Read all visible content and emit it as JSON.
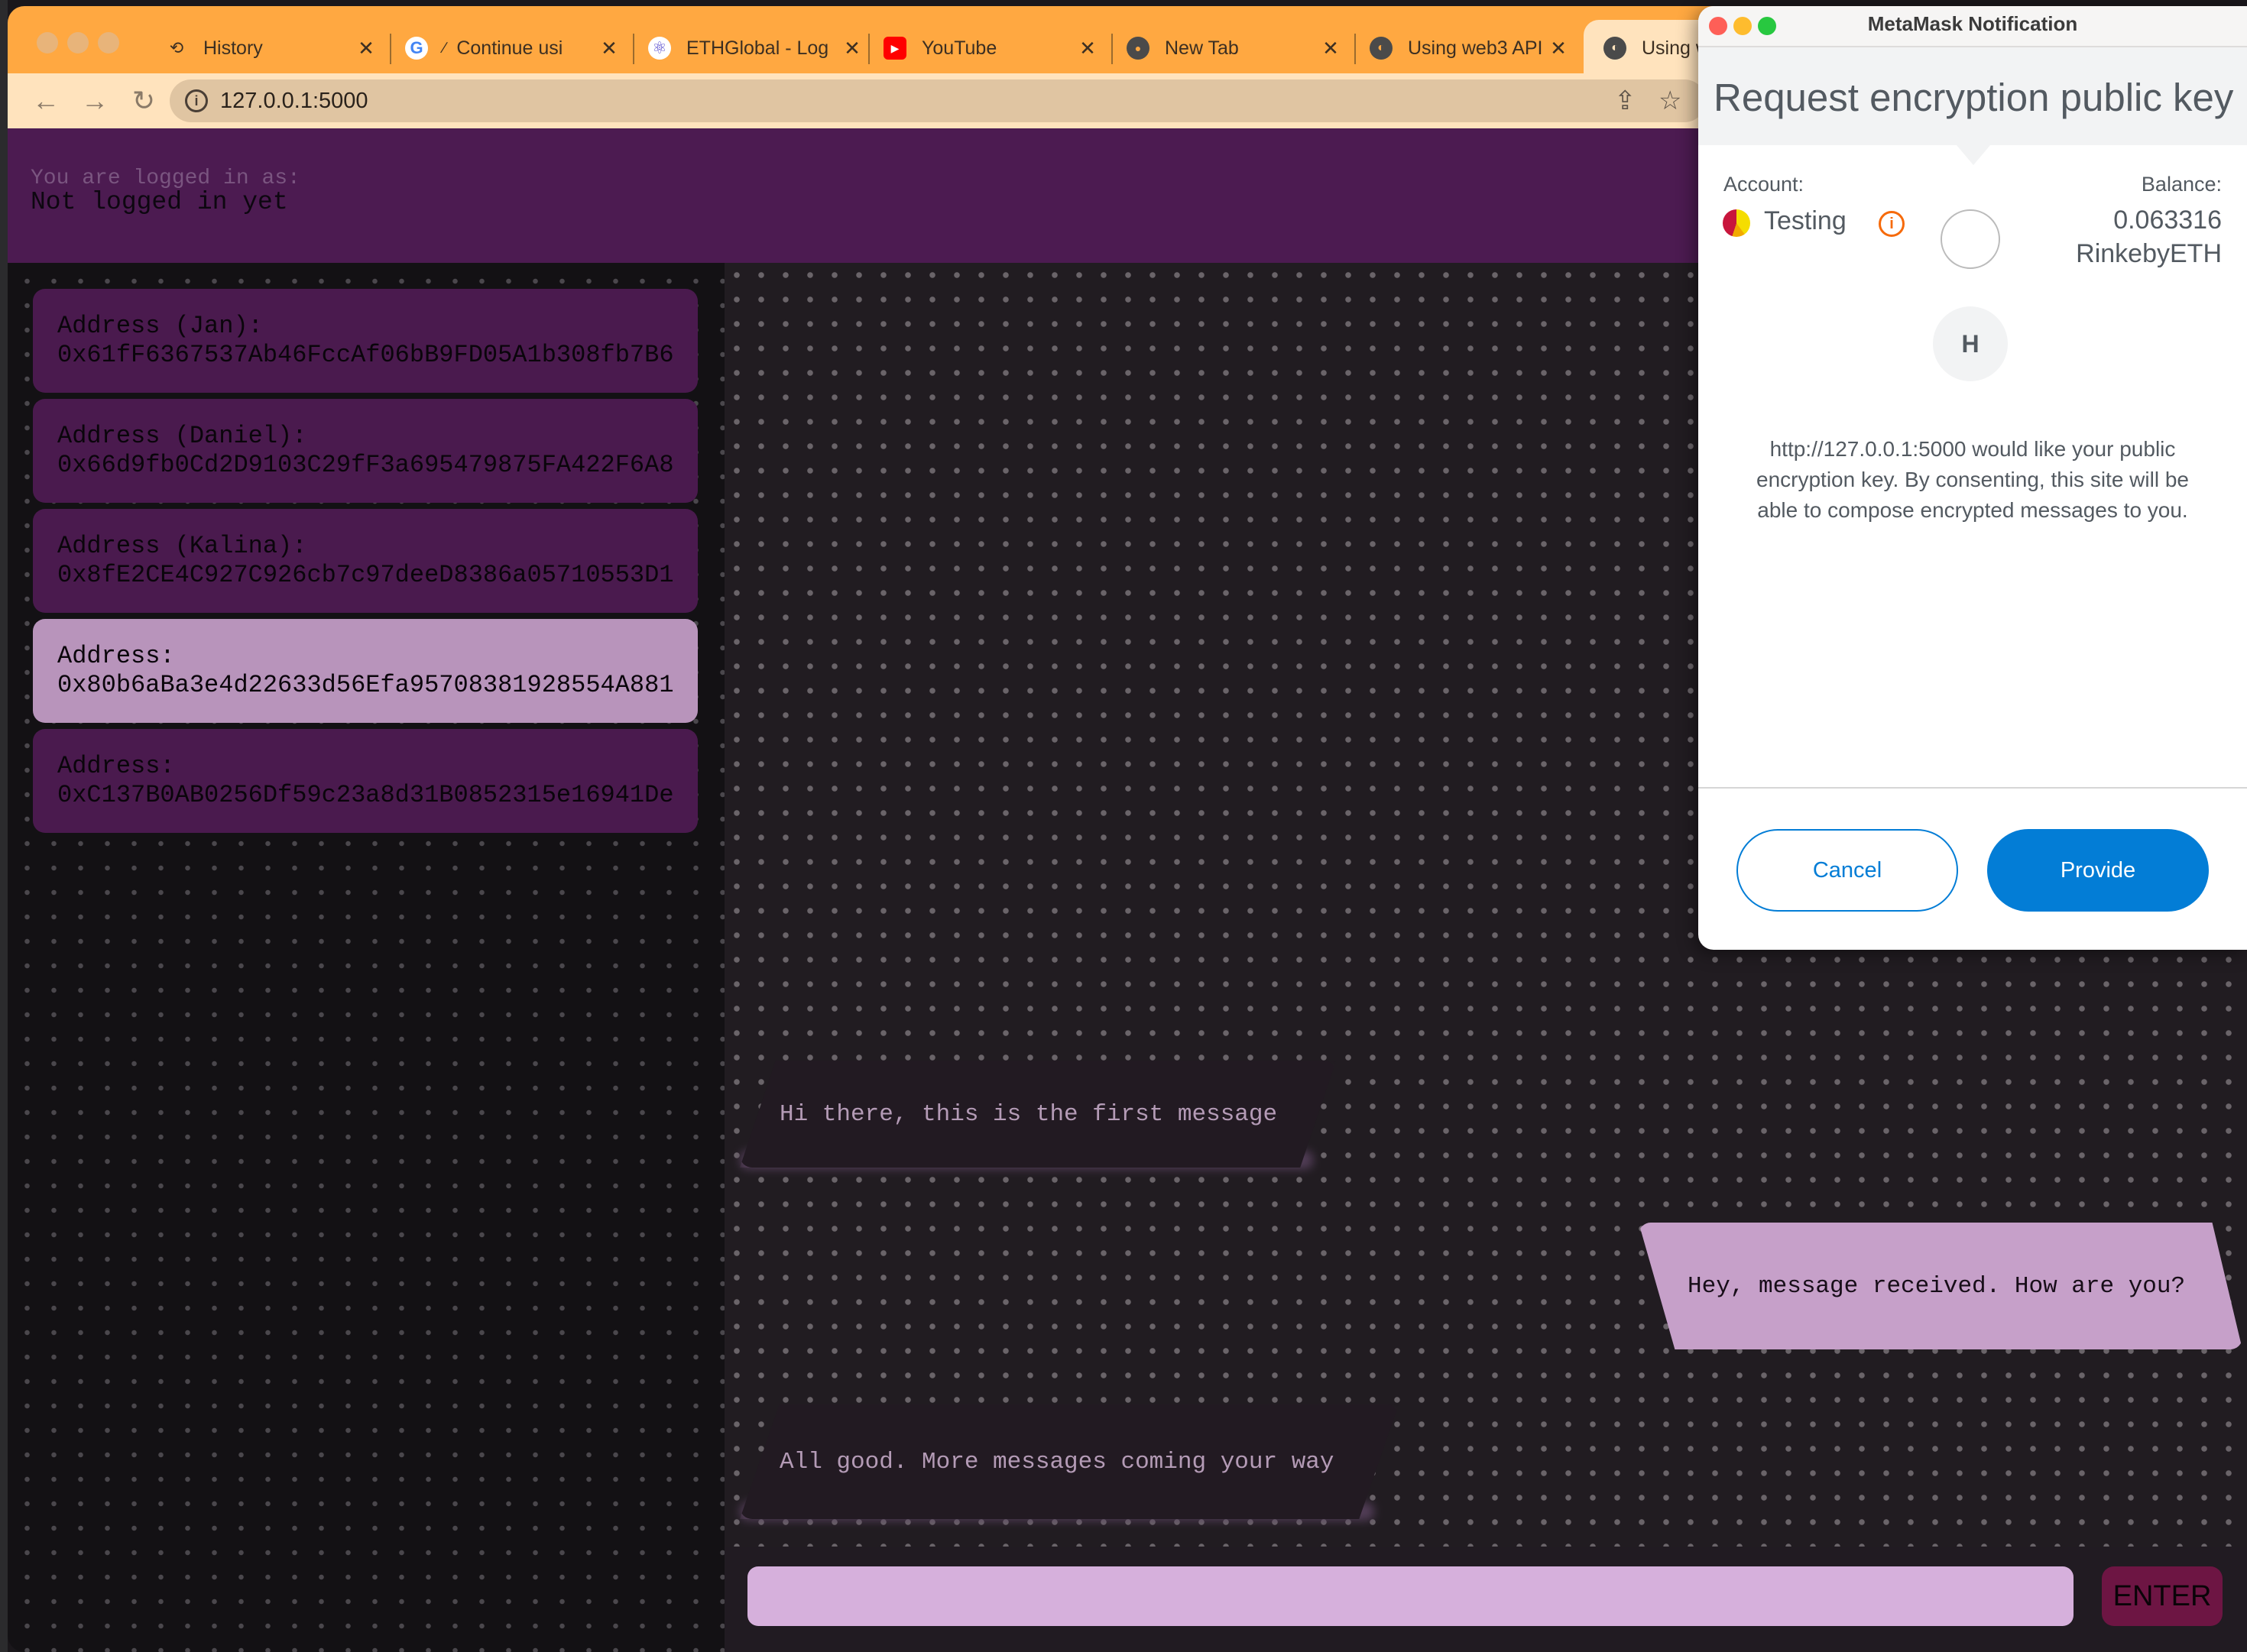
{
  "browser": {
    "tabs": [
      {
        "label": "History",
        "icon": "history-icon"
      },
      {
        "label": "Continue usi",
        "icon": "google-icon"
      },
      {
        "label": "ETHGlobal - Log",
        "icon": "ethglobal-icon"
      },
      {
        "label": "YouTube",
        "icon": "youtube-icon"
      },
      {
        "label": "New Tab",
        "icon": "chrome-icon"
      },
      {
        "label": "Using web3 API",
        "icon": "globe-icon"
      },
      {
        "label": "Using w",
        "icon": "globe-icon",
        "active": true
      }
    ],
    "url": "127.0.0.1:5000"
  },
  "header": {
    "label": "You are logged in as:",
    "value": "Not logged in yet"
  },
  "sidebar": {
    "addresses": [
      {
        "label": "Address (Jan):",
        "address": "0x61fF6367537Ab46FccAf06bB9FD05A1b308fb7B6",
        "selected": false
      },
      {
        "label": "Address (Daniel):",
        "address": "0x66d9fb0Cd2D9103C29fF3a695479875FA422F6A8",
        "selected": false
      },
      {
        "label": "Address (Kalina):",
        "address": "0x8fE2CE4C927C926cb7c97deeD8386a05710553D1",
        "selected": false
      },
      {
        "label": "Address:",
        "address": "0x80b6aBa3e4d22633d56Efa95708381928554A881",
        "selected": true
      },
      {
        "label": "Address:",
        "address": "0xC137B0AB0256Df59c23a8d31B0852315e16941De",
        "selected": false
      }
    ]
  },
  "chat": {
    "messages": [
      {
        "text": "Hi there, this is the first message",
        "direction": "incoming"
      },
      {
        "text": "Hey, message received. How are you?",
        "direction": "outgoing"
      },
      {
        "text": "All good. More messages coming your way",
        "direction": "incoming"
      }
    ],
    "input_value": "",
    "enter_label": "ENTER"
  },
  "metamask": {
    "window_title": "MetaMask Notification",
    "heading": "Request encryption public key",
    "account_label": "Account:",
    "account_name": "Testing",
    "balance_label": "Balance:",
    "balance_amount": "0.063316",
    "balance_unit": "RinkebyETH",
    "site_initial": "H",
    "description": "http://127.0.0.1:5000 would like your public encryption key. By consenting, this site will be able to compose encrypted messages to you.",
    "cancel_label": "Cancel",
    "provide_label": "Provide",
    "colors": {
      "primary": "#037dd6",
      "warning": "#f66a0a"
    }
  }
}
